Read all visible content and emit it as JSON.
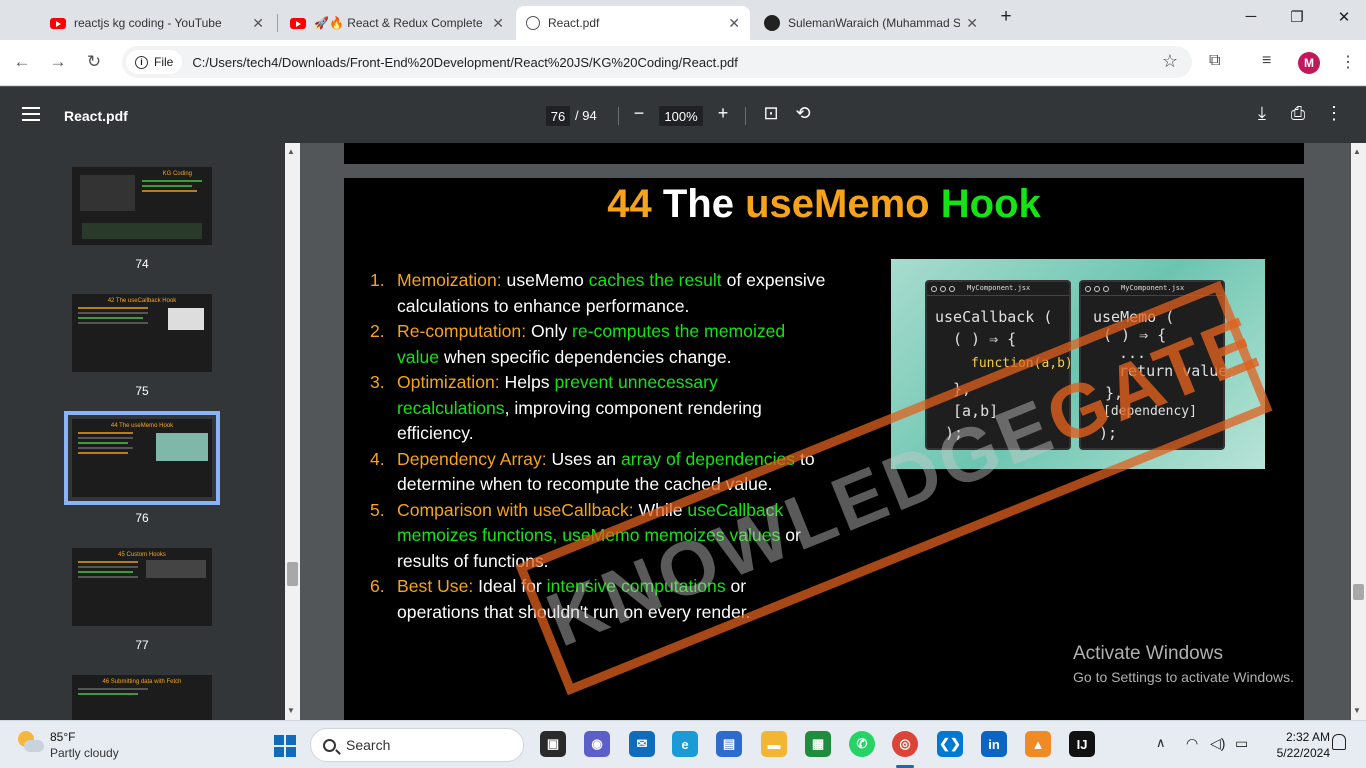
{
  "tabs": [
    {
      "title": "reactjs kg coding - YouTube",
      "icon": "youtube-icon"
    },
    {
      "title": "🚀🔥 React & Redux Complete",
      "icon": "youtube-icon"
    },
    {
      "title": "React.pdf",
      "icon": "globe-icon",
      "active": true
    },
    {
      "title": "SulemanWaraich (Muhammad S",
      "icon": "github-icon"
    }
  ],
  "address": {
    "chip_label": "File",
    "url": "C:/Users/tech4/Downloads/Front-End%20Development/React%20JS/KG%20Coding/React.pdf"
  },
  "avatar_letter": "M",
  "pdf": {
    "title": "React.pdf",
    "current_page": "76",
    "total_pages": "/ 94",
    "zoom": "100%"
  },
  "thumbnails": [
    {
      "page": "74",
      "title": "KG Coding"
    },
    {
      "page": "75",
      "title": "42 The useCallback Hook"
    },
    {
      "page": "76",
      "title": "44 The useMemo Hook",
      "selected": true
    },
    {
      "page": "77",
      "title": "45 Custom Hooks"
    },
    {
      "page": "",
      "title": "46 Submitting data with Fetch"
    }
  ],
  "slide": {
    "title_num": "44",
    "title_the": "The",
    "title_usememo": "useMemo",
    "title_hook": "Hook",
    "points": [
      {
        "num": "1.",
        "label": "Memoization:",
        "t1": " useMemo ",
        "h1": "caches the result",
        "t2": " of expensive calculations to enhance performance."
      },
      {
        "num": "2.",
        "label": "Re-computation:",
        "t1": " Only ",
        "h1": "re-computes the memoized value",
        "t2": " when specific dependencies change."
      },
      {
        "num": "3.",
        "label": "Optimization:",
        "t1": " Helps ",
        "h1": "prevent unnecessary recalculations",
        "t2": ", improving component rendering efficiency."
      },
      {
        "num": "4.",
        "label": "Dependency Array:",
        "t1": " Uses an ",
        "h1": "array of dependencies",
        "t2": " to determine when to recompute the cached value."
      },
      {
        "num": "5.",
        "label": "Comparison with useCallback:",
        "t1": " While ",
        "h1": "useCallback memoizes functions, useMemo memoizes values",
        "t2": " or results of functions."
      },
      {
        "num": "6.",
        "label": "Best Use:",
        "t1": " Ideal for ",
        "h1": "intensive computations",
        "t2": " or operations that shouldn't run on every render."
      }
    ],
    "code_left": {
      "filename": "MyComponent.jsx",
      "lines": [
        "useCallback (",
        "( ) ⇒ {",
        "function(a,b)",
        "},",
        "[a,b]",
        ");"
      ]
    },
    "code_right": {
      "filename": "MyComponent.jsx",
      "lines": [
        "useMemo (",
        "( ) ⇒ {",
        "...",
        "return value;",
        "},",
        "[dependency]",
        ");"
      ]
    },
    "watermark_part1": "KNOWLEDGE",
    "watermark_part2": "GATE"
  },
  "activation": {
    "title": "Activate Windows",
    "subtitle": "Go to Settings to activate Windows."
  },
  "taskbar": {
    "temperature": "85°F",
    "weather": "Partly cloudy",
    "search_label": "Search",
    "time": "2:32 AM",
    "date": "5/22/2024"
  },
  "colors": {
    "accent_orange": "#f7a21b",
    "accent_green": "#14e314",
    "pdf_toolbar": "#323639",
    "viewer_bg": "#525659"
  }
}
